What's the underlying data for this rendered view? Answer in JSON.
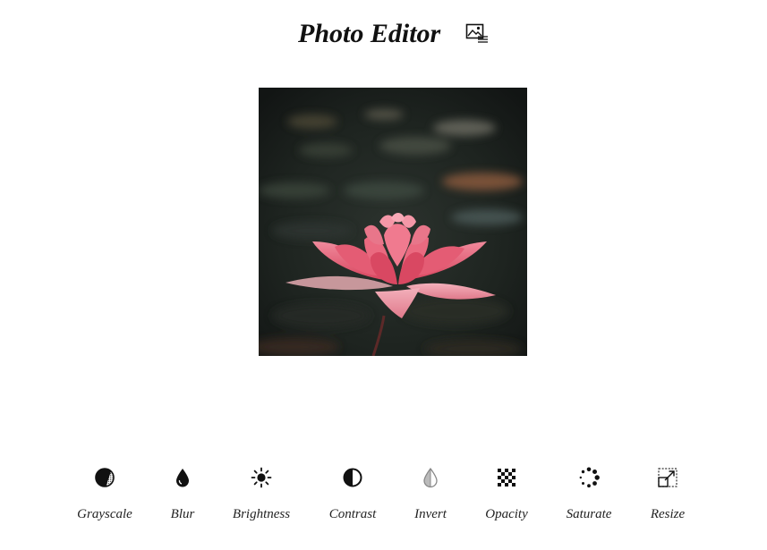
{
  "header": {
    "title": "Photo Editor",
    "title_icon": "image-edit-icon"
  },
  "main": {
    "image_subject": "pink-lotus-flower-photo"
  },
  "toolbar": {
    "tools": [
      {
        "label": "Grayscale",
        "icon": "grayscale-icon"
      },
      {
        "label": "Blur",
        "icon": "droplet-icon"
      },
      {
        "label": "Brightness",
        "icon": "sun-icon"
      },
      {
        "label": "Contrast",
        "icon": "contrast-icon"
      },
      {
        "label": "Invert",
        "icon": "invert-droplet-icon"
      },
      {
        "label": "Opacity",
        "icon": "checkerboard-icon"
      },
      {
        "label": "Saturate",
        "icon": "dotted-circle-icon"
      },
      {
        "label": "Resize",
        "icon": "resize-icon"
      }
    ]
  },
  "colors": {
    "background": "#ffffff",
    "text": "#111111",
    "icon": "#111111",
    "photo_dark": "#1d2220",
    "petal_pink": "#e0566e"
  }
}
